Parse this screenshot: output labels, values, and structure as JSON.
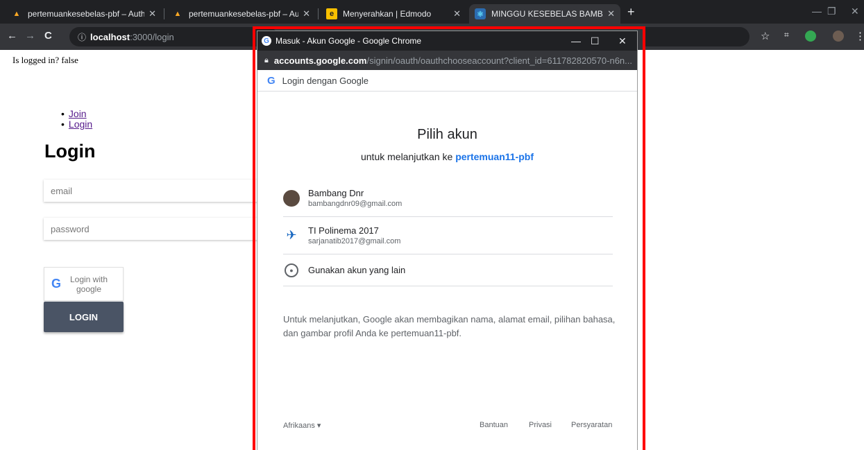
{
  "browser": {
    "tabs": [
      {
        "label": "pertemuankesebelas-pbf – Authe",
        "favicon": "firebase-icon"
      },
      {
        "label": "pertemuankesebelas-pbf – Authe",
        "favicon": "firebase-icon"
      },
      {
        "label": "Menyerahkan | Edmodo",
        "favicon": "edmodo-icon"
      },
      {
        "label": "MINGGU KESEBELAS BAMBANG",
        "favicon": "react-icon"
      }
    ],
    "address": {
      "host": "localhost",
      "path": ":3000/login"
    }
  },
  "page": {
    "status_text": "Is logged in? false",
    "nav": [
      {
        "label": "Join"
      },
      {
        "label": "Login"
      }
    ],
    "title": "Login",
    "email_placeholder": "email",
    "password_placeholder": "password",
    "google_button_label": "Login with google",
    "login_button_label": "LOGIN"
  },
  "popup": {
    "window_title": "Masuk - Akun Google - Google Chrome",
    "url_host": "accounts.google.com",
    "url_path": "/signin/oauth/oauthchooseaccount?client_id=611782820570-n6n...",
    "header_label": "Login dengan Google",
    "heading": "Pilih akun",
    "subheading_prefix": "untuk melanjutkan ke",
    "app_name": "pertemuan11-pbf",
    "accounts": [
      {
        "name": "Bambang Dnr",
        "email": "bambangdnr09@gmail.com"
      },
      {
        "name": "TI Polinema 2017",
        "email": "sarjanatib2017@gmail.com"
      }
    ],
    "other_account_label": "Gunakan akun yang lain",
    "consent_text": "Untuk melanjutkan, Google akan membagikan nama, alamat email, pilihan bahasa, dan gambar profil Anda ke pertemuan11-pbf.",
    "footer": {
      "language": "Afrikaans",
      "help": "Bantuan",
      "privacy": "Privasi",
      "terms": "Persyaratan"
    }
  },
  "colors": {
    "highlight_frame": "#ff0000",
    "link_blue": "#1a73e8",
    "login_button": "#4a5465"
  }
}
